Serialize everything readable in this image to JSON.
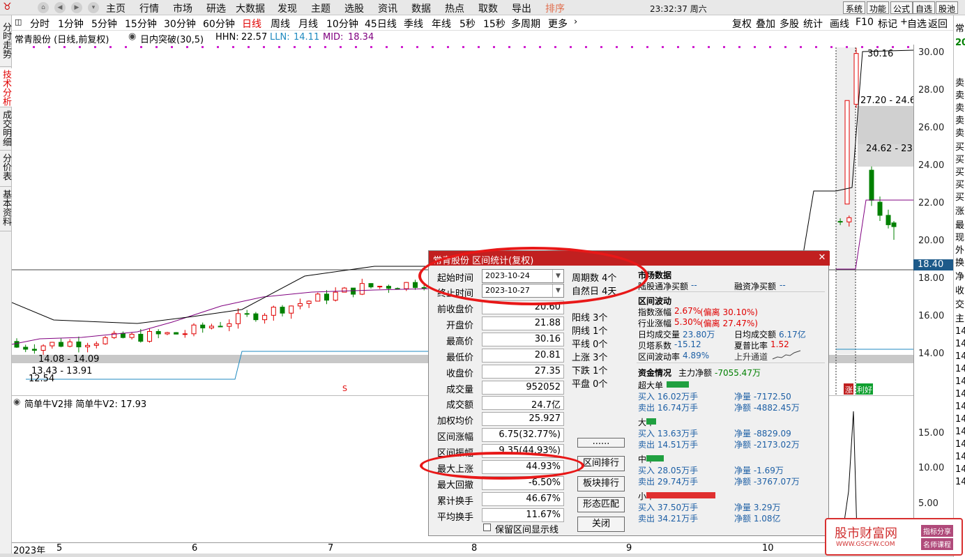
{
  "menubar": {
    "items": [
      "主页",
      "行情",
      "市场",
      "研选",
      "大数据",
      "发现",
      "主题",
      "选股",
      "资讯",
      "数据",
      "热点",
      "取数",
      "导出",
      "排序"
    ],
    "clock": "23:32:37 周六",
    "right_buttons": [
      "系统",
      "功能",
      "公式",
      "自选",
      "股池"
    ]
  },
  "left_tabs": [
    "分时走势",
    "技术分析",
    "成交明细",
    "分价表",
    "基本资料"
  ],
  "period_bar": {
    "tabs": [
      "分时",
      "1分钟",
      "5分钟",
      "15分钟",
      "30分钟",
      "60分钟",
      "日线",
      "周线",
      "月线",
      "10分钟",
      "45日线",
      "季线",
      "年线",
      "5秒",
      "15秒",
      "多周期",
      "更多"
    ],
    "active": "日线",
    "tools": [
      "复权",
      "叠加",
      "多股",
      "统计",
      "画线",
      "F10",
      "标记",
      "自选",
      "返回"
    ]
  },
  "info_line": {
    "stock": "常青股份 (日线,前复权)",
    "indicator": "日内突破(30,5)",
    "hhn_label": "HHN:",
    "hhn": "22.57",
    "lln_label": "LLN:",
    "lln": "14.11",
    "mid_label": "MID:",
    "mid": "18.34"
  },
  "chart": {
    "y_ticks": [
      "30.00",
      "28.00",
      "26.00",
      "24.00",
      "22.00",
      "20.00",
      "18.00",
      "16.00",
      "14.00"
    ],
    "current_price": "18.40",
    "annotations": {
      "high_label": "30.16",
      "zone1": "27.20 - 24.6",
      "zone2": "24.62 - 23.",
      "low_zone": "14.08 - 14.09",
      "zone3": "13.43 - 13.91",
      "low_label": "12.54",
      "signal_s": "S",
      "flag_zhang": "涨",
      "flag_li": "利好"
    },
    "colors": {
      "up": "#e00000",
      "down": "#008000",
      "purple": "#800080",
      "cyan": "#1f8ac0"
    }
  },
  "sub_chart": {
    "title": "简单牛V2排 简单牛V2: 17.93",
    "y_ticks": [
      "15.00",
      "10.00",
      "5.00"
    ]
  },
  "x_axis": {
    "labels": [
      "2023年",
      "5",
      "6",
      "7",
      "8",
      "9",
      "10"
    ]
  },
  "right_strip": [
    "常",
    "20",
    "卖",
    "卖",
    "卖",
    "卖",
    "卖",
    "买",
    "买",
    "买",
    "买",
    "买",
    "涨",
    "最",
    "现",
    "外",
    "换",
    "净",
    "收",
    "交",
    "主",
    "14",
    "14",
    "14",
    "14",
    "14",
    "14",
    "14",
    "14",
    "14",
    "14",
    "14",
    "14",
    "14"
  ],
  "dialog": {
    "title": "常青股份 区间统计(复权)",
    "start_label": "起始时间",
    "start_date": "2023-10-24",
    "end_label": "终止时间",
    "end_date": "2023-10-27",
    "fields": [
      {
        "label": "前收盘价",
        "value": "20.60"
      },
      {
        "label": "开盘价",
        "value": "21.88"
      },
      {
        "label": "最高价",
        "value": "30.16"
      },
      {
        "label": "最低价",
        "value": "20.81"
      },
      {
        "label": "收盘价",
        "value": "27.35"
      },
      {
        "label": "成交量",
        "value": "952052"
      },
      {
        "label": "成交额",
        "value": "24.7亿"
      },
      {
        "label": "加权均价",
        "value": "25.927"
      },
      {
        "label": "区间涨幅",
        "value": "6.75(32.77%)"
      },
      {
        "label": "区间振幅",
        "value": "9.35(44.93%)"
      },
      {
        "label": "最大上涨",
        "value": "44.93%"
      },
      {
        "label": "最大回撤",
        "value": "-6.50%"
      },
      {
        "label": "累计换手",
        "value": "46.67%"
      },
      {
        "label": "平均换手",
        "value": "11.67%"
      }
    ],
    "stats": [
      "周期数 4个",
      "自然日 4天",
      "阳线 3个",
      "阴线 1个",
      "平线 0个",
      "上涨 3个",
      "下跌 1个",
      "平盘 0个"
    ],
    "buttons": [
      "......",
      "区间排行",
      "板块排行",
      "形态匹配",
      "关闭"
    ],
    "keep_label": "保留区间显示线",
    "market": {
      "title": "市场数据",
      "lugutong_label": "陆股通净买额",
      "lugutong": "--",
      "rongzi_label": "融资净买额",
      "rongzi": "--"
    },
    "wave": {
      "title": "区间波动",
      "items": [
        {
          "label": "指数涨幅",
          "value": "2.67%",
          "extra": "(偏离 30.10%)"
        },
        {
          "label": "行业涨幅",
          "value": "5.30%",
          "extra": "(偏离 27.47%)"
        },
        {
          "label": "日均成交量",
          "value": "23.80万"
        },
        {
          "label": "日均成交额",
          "value": "6.17亿"
        },
        {
          "label": "贝塔系数",
          "value": "-15.12"
        },
        {
          "label": "夏普比率",
          "value": "1.52"
        },
        {
          "label": "区间波动率",
          "value": "4.89%"
        },
        {
          "label": "上升通道",
          "value": ""
        }
      ]
    },
    "funds": {
      "title": "资金情况",
      "main_label": "主力净额",
      "main": "-7055.47万",
      "groups": [
        {
          "name": "超大单",
          "buy": "买入 16.02万手",
          "sell": "卖出 16.74万手",
          "net_vol": "净量 -7172.50",
          "net_amt": "净额 -4882.45万",
          "bar_color": "#20a040",
          "bar_pct": 0.18
        },
        {
          "name": "大单",
          "buy": "买入 13.63万手",
          "sell": "卖出 14.51万手",
          "net_vol": "净量 -8829.09",
          "net_amt": "净额 -2173.02万",
          "bar_color": "#20a040",
          "bar_pct": 0.08
        },
        {
          "name": "中单",
          "buy": "买入 28.05万手",
          "sell": "卖出 29.74万手",
          "net_vol": "净量 -1.69万",
          "net_amt": "净额 -3767.07万",
          "bar_color": "#20a040",
          "bar_pct": 0.14
        },
        {
          "name": "小单",
          "buy": "买入 37.50万手",
          "sell": "卖出 34.21万手",
          "net_vol": "净量 3.29万",
          "net_amt": "净额 1.08亿",
          "bar_color": "#e03030",
          "bar_pct": 0.55
        }
      ]
    }
  },
  "watermark": {
    "title": "股市财富网",
    "url": "WWW.GSCFW.COM",
    "tag1": "指标分享",
    "tag2": "名师课程"
  }
}
